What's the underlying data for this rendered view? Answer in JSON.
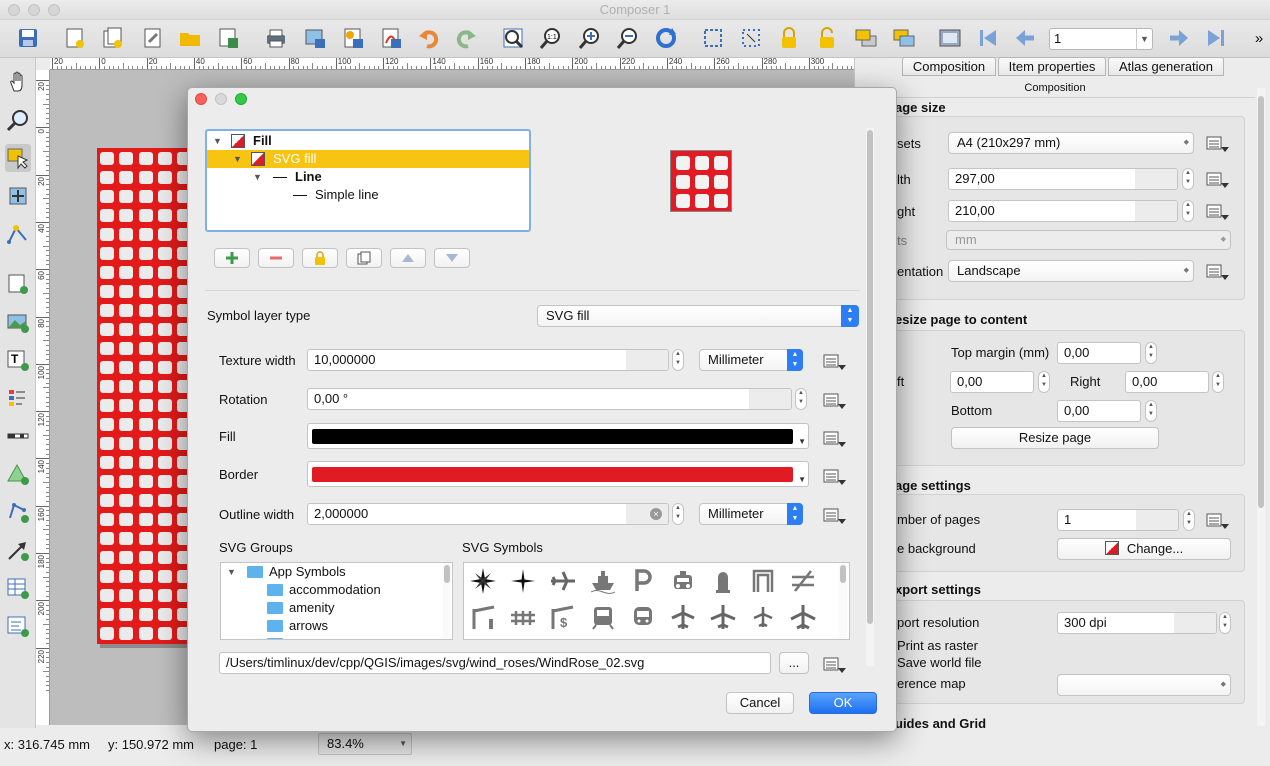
{
  "window": {
    "title": "Composer 1"
  },
  "toolbar": {
    "icons": [
      "save-icon",
      "new-composer-icon",
      "duplicate-composer-icon",
      "composer-manager-icon",
      "open-template-icon",
      "save-template-icon",
      "print-icon",
      "export-image-icon",
      "export-svg-icon",
      "export-pdf-icon",
      "export-pdf-alt-icon",
      "undo-icon",
      "redo-icon",
      "zoom-full-icon",
      "zoom-actual-icon",
      "zoom-in-icon",
      "zoom-out-icon",
      "refresh-icon",
      "select-all-icon",
      "deselect-icon",
      "lock-icon",
      "unlock-icon",
      "raise-icon",
      "lower-icon",
      "atlas-preview-icon",
      "first-feature-icon",
      "prev-feature-icon",
      "next-feature-icon",
      "last-feature-icon"
    ],
    "page_value": "1",
    "overflow": "»"
  },
  "left_toolbar": {
    "icons": [
      "pan-icon",
      "zoom-tool-icon",
      "select-tool-icon",
      "move-content-icon",
      "edit-nodes-icon",
      "add-map-icon",
      "add-image-icon",
      "add-label-icon",
      "add-legend-icon",
      "add-scalebar-icon",
      "add-shape-icon",
      "add-nodes-icon",
      "add-arrow-icon",
      "add-attribute-table-icon",
      "add-html-icon"
    ]
  },
  "ruler": {
    "h_labels": [
      "20",
      "0",
      "20",
      "40",
      "60",
      "80",
      "100",
      "120",
      "140",
      "160",
      "180",
      "200",
      "220",
      "240",
      "260",
      "280",
      "300"
    ],
    "v_labels": [
      "20",
      "0",
      "20",
      "40",
      "60",
      "80",
      "100",
      "120",
      "140",
      "160",
      "180",
      "200",
      "220"
    ]
  },
  "status": {
    "x": "x: 316.745 mm",
    "y": "y: 150.972 mm",
    "page": "page: 1",
    "zoom": "83.4%"
  },
  "panel": {
    "tabs": [
      "Composition",
      "Item properties",
      "Atlas generation"
    ],
    "header": "Composition",
    "page_size": {
      "title": "age size",
      "presets_label": "sets",
      "presets_value": "A4 (210x297 mm)",
      "width_label": "lth",
      "width_value": "297,00",
      "height_label": "ght",
      "height_value": "210,00",
      "units_label": "ts",
      "units_value": "mm",
      "orientation_label": "entation",
      "orientation_value": "Landscape"
    },
    "resize": {
      "title": "esize page to content",
      "top_label": "Top margin (mm)",
      "top_value": "0,00",
      "left_label": "ft",
      "left_value": "0,00",
      "right_label": "Right",
      "right_value": "0,00",
      "bottom_label": "Bottom",
      "bottom_value": "0,00",
      "button": "Resize page"
    },
    "page_settings": {
      "title": "age settings",
      "pages_label": "mber of pages",
      "pages_value": "1",
      "bg_label": "e background",
      "bg_button": "Change..."
    },
    "export": {
      "title": "xport settings",
      "res_label": "port resolution",
      "res_value": "300 dpi",
      "raster_label": "Print as raster",
      "world_label": "Save world file",
      "ref_label": "erence map"
    },
    "guides": {
      "title": "uides and Grid"
    }
  },
  "dialog": {
    "tree": [
      {
        "label": "Fill",
        "bold": true
      },
      {
        "label": "SVG fill",
        "bold": false
      },
      {
        "label": "Line",
        "bold": true
      },
      {
        "label": "Simple line",
        "bold": false
      }
    ],
    "symbol_type_label": "Symbol layer type",
    "symbol_type_value": "SVG fill",
    "texture_width_label": "Texture width",
    "texture_width_value": "10,000000",
    "texture_unit": "Millimeter",
    "rotation_label": "Rotation",
    "rotation_value": "0,00 °",
    "fill_label": "Fill",
    "fill_color": "#000000",
    "border_label": "Border",
    "border_color": "#e01b24",
    "outline_width_label": "Outline width",
    "outline_width_value": "2,000000",
    "outline_unit": "Millimeter",
    "svg_groups_label": "SVG Groups",
    "svg_symbols_label": "SVG Symbols",
    "groups": [
      "App Symbols",
      "accommodation",
      "amenity",
      "arrows"
    ],
    "path_value": "/Users/timlinux/dev/cpp/QGIS/images/svg/wind_roses/WindRose_02.svg",
    "browse_label": "...",
    "cancel_label": "Cancel",
    "ok_label": "OK"
  }
}
